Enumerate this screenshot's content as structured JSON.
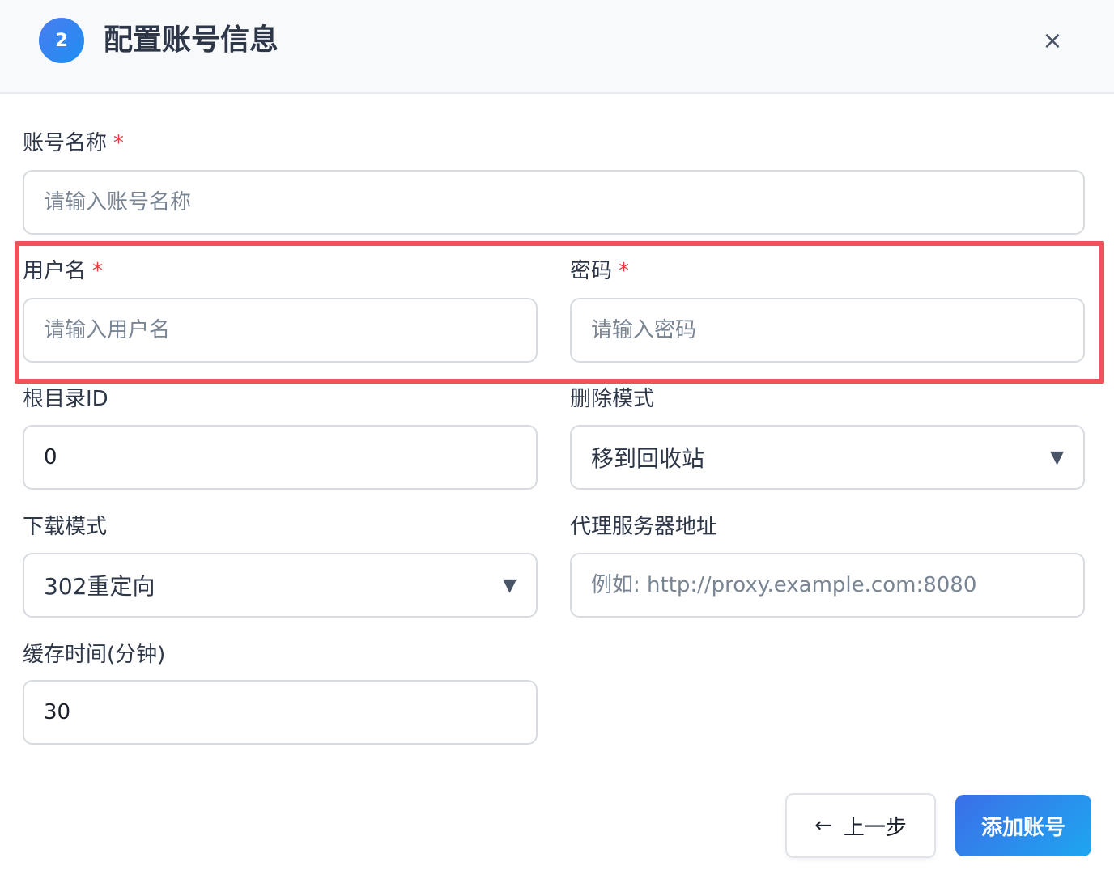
{
  "header": {
    "step": "2",
    "title": "配置账号信息",
    "close_icon": "×"
  },
  "form": {
    "account_name": {
      "label": "账号名称",
      "required_mark": "*",
      "placeholder": "请输入账号名称",
      "value": ""
    },
    "username": {
      "label": "用户名",
      "required_mark": "*",
      "placeholder": "请输入用户名",
      "value": ""
    },
    "password": {
      "label": "密码",
      "required_mark": "*",
      "placeholder": "请输入密码",
      "value": ""
    },
    "root_dir_id": {
      "label": "根目录ID",
      "value": "0"
    },
    "delete_mode": {
      "label": "删除模式",
      "selected": "移到回收站",
      "caret": "▼"
    },
    "download_mode": {
      "label": "下载模式",
      "selected": "302重定向",
      "caret": "▼"
    },
    "proxy": {
      "label": "代理服务器地址",
      "placeholder": "例如: http://proxy.example.com:8080",
      "value": ""
    },
    "cache_time": {
      "label": "缓存时间(分钟)",
      "value": "30"
    }
  },
  "footer": {
    "back_arrow": "←",
    "back_label": "上一步",
    "add_label": "添加账号"
  },
  "colors": {
    "accent": "#3b6fe8",
    "required": "#e53e3e",
    "highlight": "#f0535a"
  }
}
